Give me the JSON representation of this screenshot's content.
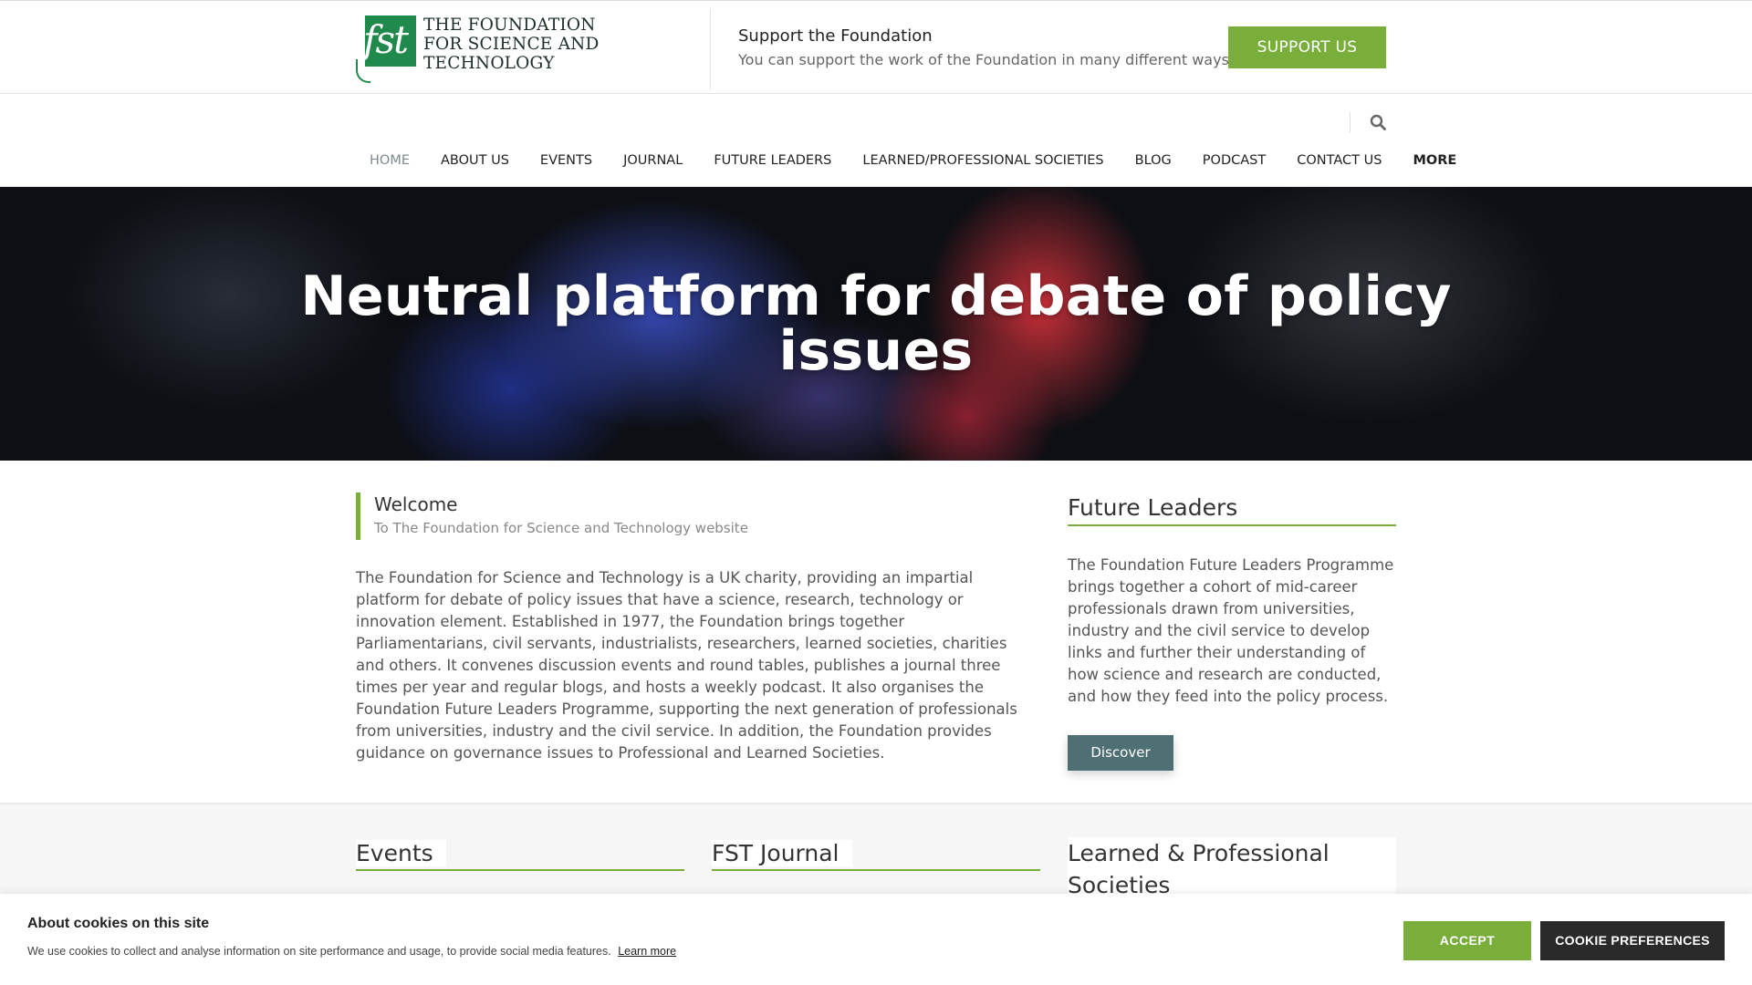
{
  "logo": {
    "mark_text": "fst",
    "lines": [
      "THE FOUNDATION",
      "FOR SCIENCE AND",
      "TECHNOLOGY"
    ]
  },
  "support": {
    "title": "Support the Foundation",
    "subtitle": "You can support the work of the Foundation in many different ways",
    "button_label": "SUPPORT US"
  },
  "nav": {
    "items": [
      "HOME",
      "ABOUT US",
      "EVENTS",
      "JOURNAL",
      "FUTURE LEADERS",
      "LEARNED/PROFESSIONAL SOCIETIES",
      "BLOG",
      "PODCAST",
      "CONTACT US",
      "MORE"
    ],
    "active": "HOME",
    "search_icon": "search-icon"
  },
  "hero": {
    "line1": "Neutral platform for debate of policy",
    "line2": "issues"
  },
  "welcome": {
    "title": "Welcome",
    "subtitle": "To The Foundation for Science and Technology website",
    "body": "The Foundation for Science and Technology is a UK charity, providing an impartial platform for debate of policy issues that have a science, research, technology or innovation element. Established in 1977, the Foundation brings together Parliamentarians, civil servants, industrialists, researchers, learned societies, charities and others. It convenes discussion events and round tables, publishes a journal three times per year and regular blogs, and hosts a weekly podcast. It also organises the Foundation Future Leaders Programme, supporting the next generation of professionals from universities, industry and the civil service. In addition, the Foundation provides guidance on governance issues to Professional and Learned Societies."
  },
  "future_leaders": {
    "heading": "Future Leaders",
    "body": "The Foundation Future Leaders Programme brings together a cohort of mid-career professionals drawn from universities, industry and the civil service to develop links and further their understanding of how science and research are conducted, and how they feed into the policy process.",
    "button_label": "Discover"
  },
  "sections": {
    "events": "Events",
    "journal": "FST Journal",
    "societies_line1": "Learned & Professional",
    "societies_line2": "Societies"
  },
  "cookie": {
    "title": "About cookies on this site",
    "text": "We use cookies to collect and analyse information on site performance and usage, to provide social media features.",
    "link": "Learn more",
    "accept": "ACCEPT",
    "preferences": "COOKIE PREFERENCES"
  },
  "colors": {
    "accent": "#7aae3b",
    "logo_green": "#1f8a4c",
    "button_slate": "#4e7074",
    "dark_button": "#2a2a2a"
  }
}
